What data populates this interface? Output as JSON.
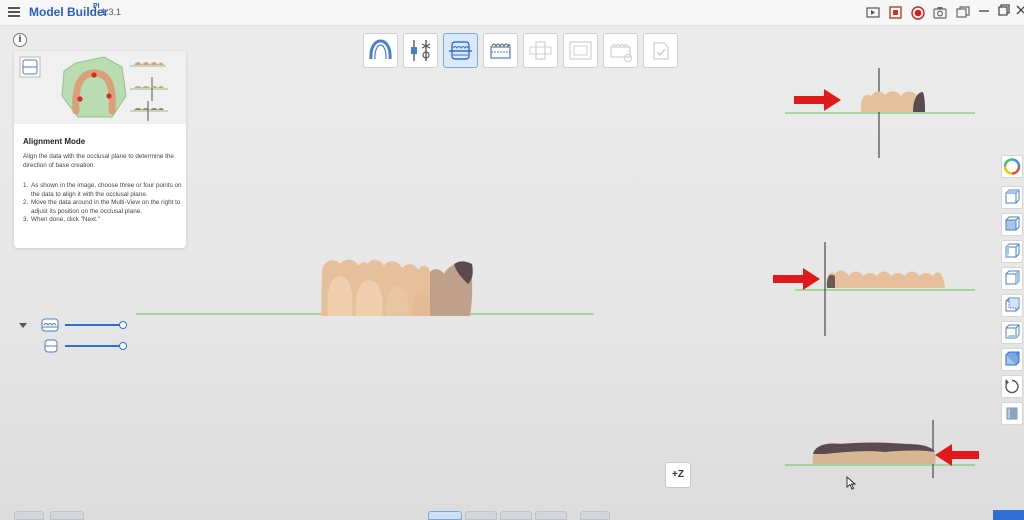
{
  "app": {
    "title": "Model Builder",
    "sup": "PI",
    "version": "1.3.1"
  },
  "guide": {
    "title": "Alignment Mode",
    "description": "Align the data with the occlusal plane to determine the direction of base creation.",
    "steps": [
      {
        "num": "1.",
        "text": "As shown in the image, choose three or four points on the data to align it with the occlusal plane."
      },
      {
        "num": "2.",
        "text": "Move the data around in the Multi-View on the right to adjust its position on the occlusal plane."
      },
      {
        "num": "3.",
        "text": "When done, click \"Next.\""
      }
    ]
  },
  "toolbar": {
    "tools": [
      {
        "name": "arch-tool",
        "state": "normal"
      },
      {
        "name": "trim-tool",
        "state": "normal"
      },
      {
        "name": "alignment-tool",
        "state": "active"
      },
      {
        "name": "base-tool",
        "state": "normal"
      },
      {
        "name": "die-tool",
        "state": "disabled"
      },
      {
        "name": "frame-tool",
        "state": "disabled"
      },
      {
        "name": "label-tool",
        "state": "disabled"
      },
      {
        "name": "finish-tool",
        "state": "disabled"
      }
    ]
  },
  "view": {
    "z_button": "+Z"
  },
  "colors": {
    "accent": "#2f6fd3",
    "arrow": "#e0191b",
    "tooth": "#e9c39d",
    "plane": "#7ccc72"
  }
}
